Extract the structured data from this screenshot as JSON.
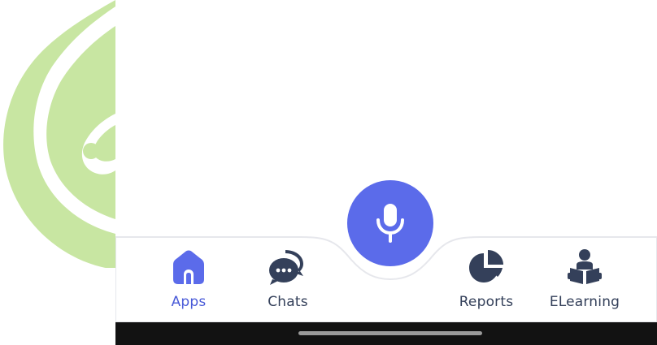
{
  "nav": {
    "mic_icon": "microphone-icon",
    "items": [
      {
        "label": "Apps",
        "icon": "home-icon",
        "active": true
      },
      {
        "label": "Chats",
        "icon": "chat-bubbles-icon",
        "active": false
      },
      {
        "label": "Reports",
        "icon": "pie-chart-icon",
        "active": false
      },
      {
        "label": "ELearning",
        "icon": "reader-icon",
        "active": false
      }
    ]
  },
  "colors": {
    "accent": "#5b6bea",
    "active_label": "#4a5bd8",
    "icon_dark": "#34405a",
    "watermark": "#c8e6a2",
    "system_bar": "#121212"
  }
}
